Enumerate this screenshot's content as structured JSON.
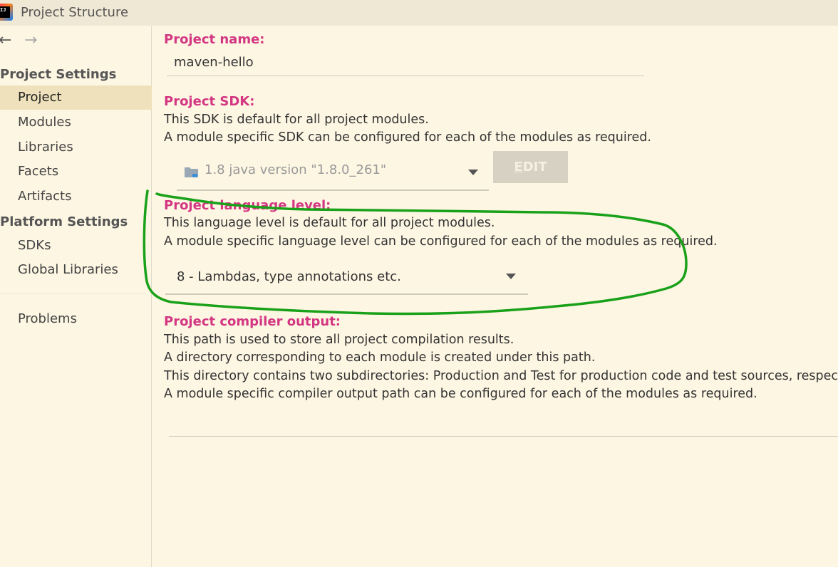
{
  "window": {
    "title": "Project Structure",
    "app_icon_text": "IJ"
  },
  "nav": {
    "back_glyph": "←",
    "forward_glyph": "→"
  },
  "sidebar": {
    "project_settings_header": "Project Settings",
    "platform_settings_header": "Platform Settings",
    "items": [
      {
        "label": "Project",
        "selected": true
      },
      {
        "label": "Modules"
      },
      {
        "label": "Libraries"
      },
      {
        "label": "Facets"
      },
      {
        "label": "Artifacts"
      }
    ],
    "platform_items": [
      {
        "label": "SDKs"
      },
      {
        "label": "Global Libraries"
      }
    ],
    "problems_label": "Problems"
  },
  "project_name": {
    "label": "Project name:",
    "value": "maven-hello"
  },
  "project_sdk": {
    "label": "Project SDK:",
    "desc_1": "This SDK is default for all project modules.",
    "desc_2": "A module specific SDK can be configured for each of the modules as required.",
    "value": "1.8 java version \"1.8.0_261\"",
    "edit_label_mnemonic": "E",
    "edit_label_rest": "DIT"
  },
  "language_level": {
    "label": "Project language level:",
    "desc_1": "This language level is default for all project modules.",
    "desc_2": "A module specific language level can be configured for each of the modules as required.",
    "value": "8 - Lambdas, type annotations etc."
  },
  "compiler_output": {
    "label": "Project compiler output:",
    "desc_1": "This path is used to store all project compilation results.",
    "desc_2": "A directory corresponding to each module is created under this path.",
    "desc_3": "This directory contains two subdirectories: Production and Test for production code and test sources, respectiv",
    "desc_4": "A module specific compiler output path can be configured for each of the modules as required.",
    "value": ""
  },
  "colors": {
    "background": "#fdf6e3",
    "titlebar": "#eee8d5",
    "selected_item": "#eee1bb",
    "label_accent": "#d33682",
    "annotation_stroke": "#1aa11a"
  }
}
